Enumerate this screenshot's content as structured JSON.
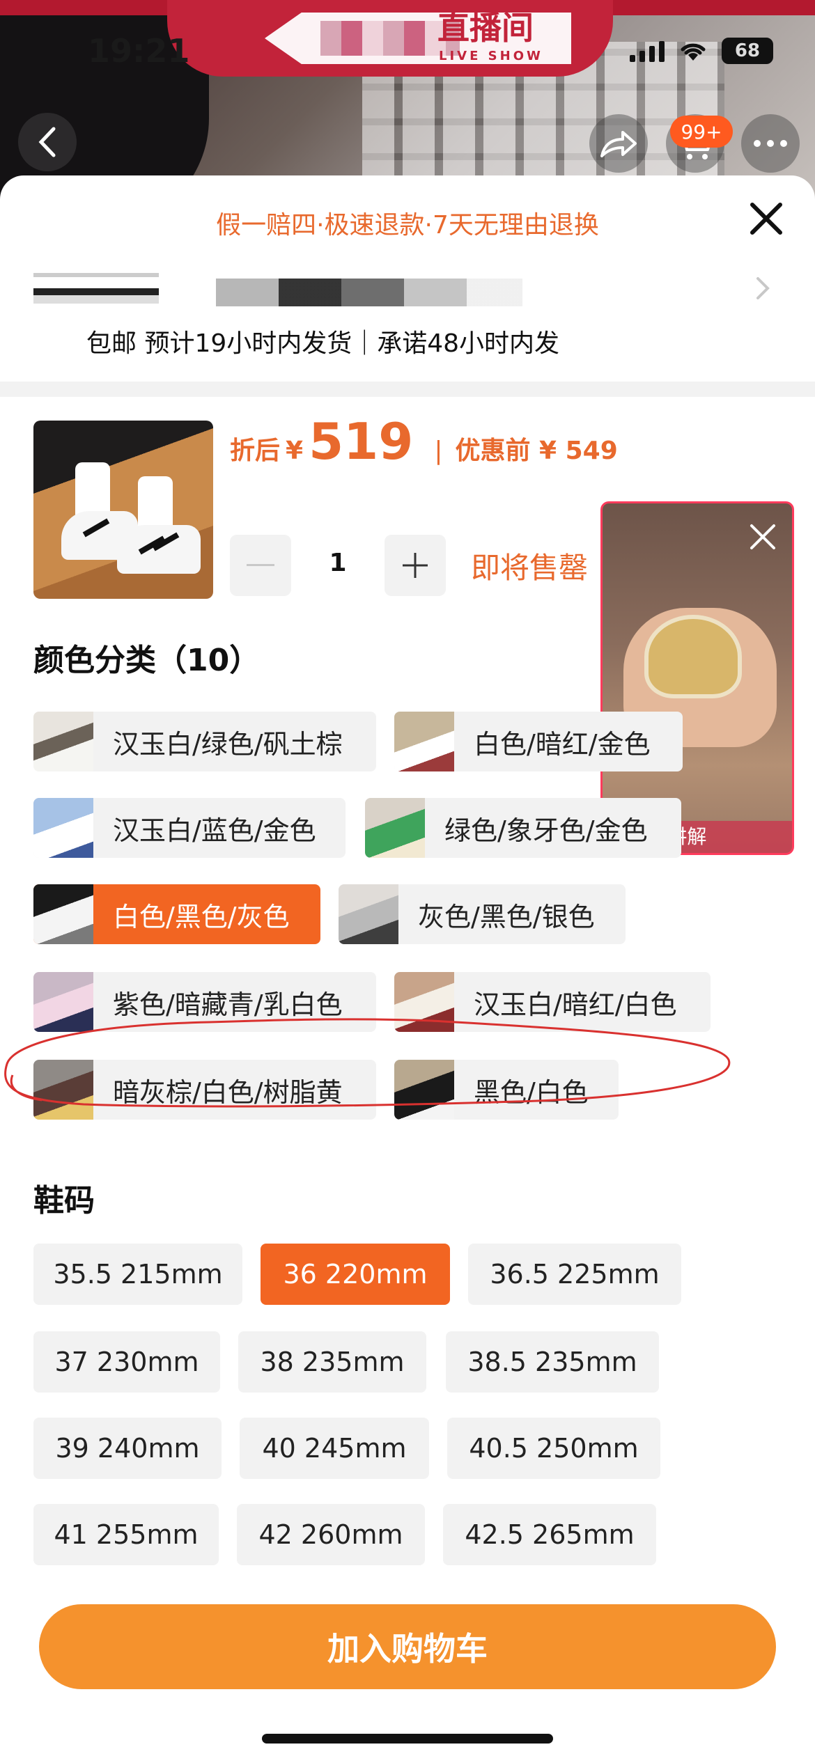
{
  "status_bar": {
    "time": "19:21",
    "battery": "68"
  },
  "live_banner": {
    "title": "直播间",
    "subtitle": "LIVE SHOW"
  },
  "nav": {
    "cart_badge": "99+"
  },
  "sheet": {
    "guarantee": "假一赔四·极速退款·7天无理由退换",
    "shipping": "包邮 预计19小时内发货｜承诺48小时内发"
  },
  "product": {
    "discount_label": "折后",
    "currency": "¥",
    "price": "519",
    "separator": "|",
    "before_label": "优惠前 ¥ 549",
    "quantity": "1",
    "stock_status": "即将售罄"
  },
  "live_float": {
    "label": "• 直播讲解"
  },
  "colors": {
    "title": "颜色分类（10）",
    "options": [
      "汉玉白/绿色/矾土棕",
      "白色/暗红/金色",
      "汉玉白/蓝色/金色",
      "绿色/象牙色/金色",
      "白色/黑色/灰色",
      "灰色/黑色/银色",
      "紫色/暗藏青/乳白色",
      "汉玉白/暗红/白色",
      "暗灰棕/白色/树脂黄",
      "黑色/白色"
    ],
    "selected": "白色/黑色/灰色"
  },
  "sizes": {
    "title": "鞋码",
    "options": [
      "35.5 215mm",
      "36 220mm",
      "36.5 225mm",
      "37 230mm",
      "38 235mm",
      "38.5 235mm",
      "39 240mm",
      "40 245mm",
      "40.5 250mm",
      "41 255mm",
      "42 260mm",
      "42.5 265mm"
    ],
    "selected": "36 220mm"
  },
  "add_to_cart": "加入购物车",
  "accent_colors": {
    "orange": "#f26522",
    "price": "#e8692d",
    "cta": "#f5922d",
    "annotation": "#d9312f"
  }
}
